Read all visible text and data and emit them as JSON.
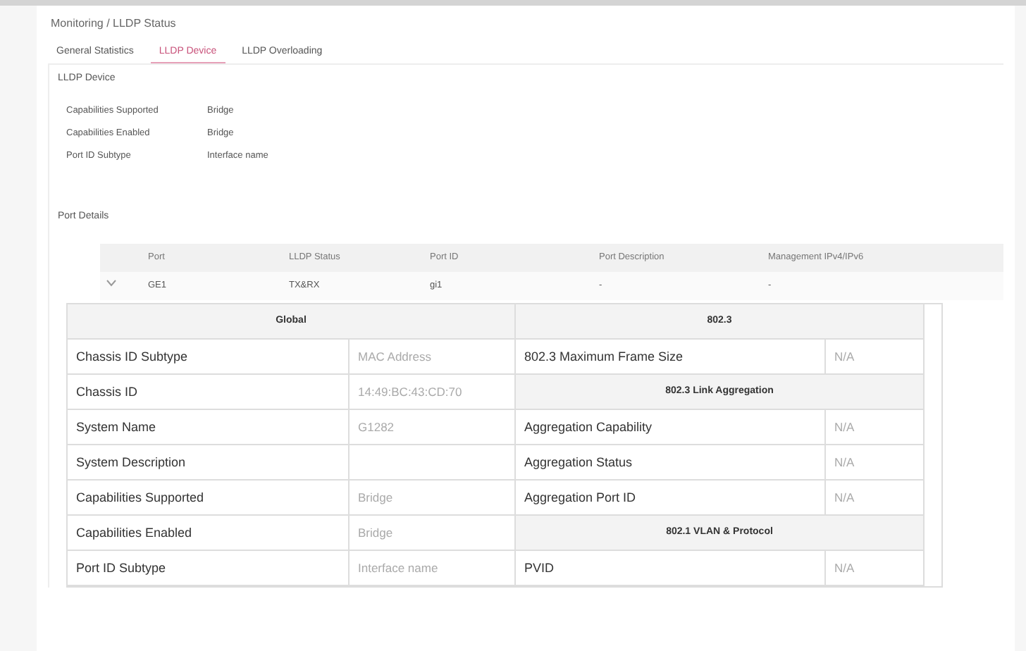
{
  "breadcrumb": "Monitoring / LLDP Status",
  "tabs": [
    {
      "label": "General Statistics",
      "selected": false
    },
    {
      "label": "LLDP Device",
      "selected": true
    },
    {
      "label": "LLDP Overloading",
      "selected": false
    }
  ],
  "device": {
    "title": "LLDP Device",
    "fields": [
      {
        "label": "Capabilities Supported",
        "value": "Bridge"
      },
      {
        "label": "Capabilities Enabled",
        "value": "Bridge"
      },
      {
        "label": "Port ID Subtype",
        "value": "Interface name"
      }
    ]
  },
  "port_details": {
    "title": "Port Details",
    "columns": [
      "Port",
      "LLDP Status",
      "Port ID",
      "Port Description",
      "Management IPv4/IPv6"
    ],
    "rows": [
      {
        "expanded": true,
        "cells": [
          "GE1",
          "TX&RX",
          "gi1",
          "-",
          "-"
        ]
      }
    ]
  },
  "detail": {
    "global": {
      "title": "Global",
      "rows": [
        {
          "label": "Chassis ID Subtype",
          "value": "MAC Address"
        },
        {
          "label": "Chassis ID",
          "value": "14:49:BC:43:CD:70"
        },
        {
          "label": "System Name",
          "value": "G1282"
        },
        {
          "label": "System Description"
        },
        {
          "label": "Capabilities Supported",
          "value": "Bridge"
        },
        {
          "label": "Capabilities Enabled",
          "value": "Bridge"
        },
        {
          "label": "Port ID Subtype",
          "value": "Interface name"
        }
      ]
    },
    "right": [
      {
        "kind": "header",
        "label": "802.3"
      },
      {
        "kind": "pair",
        "label": "802.3 Maximum Frame Size",
        "value": "N/A"
      },
      {
        "kind": "header",
        "label": "802.3 Link Aggregation"
      },
      {
        "kind": "pair",
        "label": "Aggregation Capability",
        "value": "N/A"
      },
      {
        "kind": "pair",
        "label": "Aggregation Status",
        "value": "N/A"
      },
      {
        "kind": "pair",
        "label": "Aggregation Port ID",
        "value": "N/A"
      },
      {
        "kind": "header",
        "label": "802.1 VLAN & Protocol"
      },
      {
        "kind": "pair",
        "label": "PVID",
        "value": "N/A"
      }
    ]
  }
}
